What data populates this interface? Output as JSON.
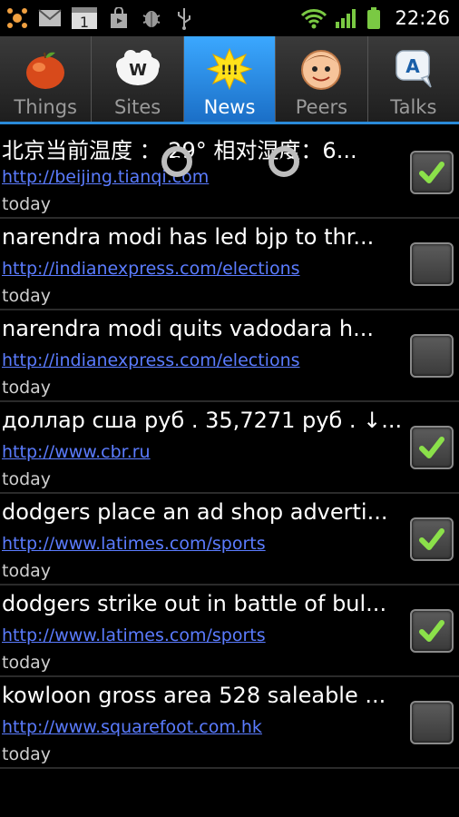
{
  "status_bar": {
    "time": "22:26",
    "left_icons": [
      "app-logo-icon",
      "gmail-icon",
      "calendar-icon",
      "shopping-bag-icon",
      "android-debug-icon",
      "usb-icon"
    ],
    "calendar_day": "1",
    "right_icons": [
      "wifi-icon",
      "signal-icon",
      "battery-icon"
    ]
  },
  "tabs": [
    {
      "label": "Things",
      "icon": "apple-icon",
      "selected": false
    },
    {
      "label": "Sites",
      "icon": "cloud-w-icon",
      "selected": false
    },
    {
      "label": "News",
      "icon": "starburst-icon",
      "selected": true
    },
    {
      "label": "Peers",
      "icon": "face-icon",
      "selected": false
    },
    {
      "label": "Talks",
      "icon": "speech-bubble-icon",
      "selected": false
    }
  ],
  "news_items": [
    {
      "title": "北京当前温度 ： 29° 相对湿度：6...",
      "url": "http://beijing.tianqi.com",
      "date": "today",
      "checked": true
    },
    {
      "title": "narendra modi has led bjp to thr...",
      "url": "http://indianexpress.com/elections",
      "date": "today",
      "checked": false
    },
    {
      "title": "narendra modi quits vadodara h...",
      "url": "http://indianexpress.com/elections",
      "date": "today",
      "checked": false
    },
    {
      "title": "доллар сша руб . 35,7271 руб . ↓...",
      "url": "http://www.cbr.ru",
      "date": "today",
      "checked": true
    },
    {
      "title": "dodgers place an ad shop adverti...",
      "url": "http://www.latimes.com/sports",
      "date": "today",
      "checked": true
    },
    {
      "title": "dodgers strike out in battle of bul...",
      "url": "http://www.latimes.com/sports",
      "date": "today",
      "checked": true
    },
    {
      "title": "kowloon gross area 528 saleable ...",
      "url": "http://www.squarefoot.com.hk",
      "date": "today",
      "checked": false
    }
  ],
  "colors": {
    "accent": "#2a8ad8",
    "link": "#5b7cff",
    "check": "#8be04a"
  }
}
